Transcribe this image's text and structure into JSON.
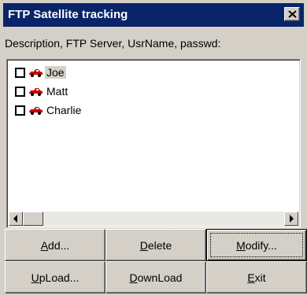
{
  "window": {
    "title": "FTP Satellite tracking",
    "close_label": "×"
  },
  "header_label": "Description, FTP Server, UsrName, passwd:",
  "list": {
    "items": [
      {
        "label": "Joe",
        "checked": false,
        "selected": true
      },
      {
        "label": "Matt",
        "checked": false,
        "selected": false
      },
      {
        "label": "Charlie",
        "checked": false,
        "selected": false
      }
    ]
  },
  "buttons": {
    "add": {
      "accel": "A",
      "rest": "dd..."
    },
    "delete": {
      "accel": "D",
      "rest": "elete"
    },
    "modify": {
      "accel": "M",
      "rest": "odify..."
    },
    "upload": {
      "accel": "U",
      "rest": "pLoad..."
    },
    "download": {
      "accel": "D",
      "rest": "ownLoad"
    },
    "exit": {
      "accel": "E",
      "rest": "xit"
    }
  },
  "colors": {
    "titlebar": "#0a246a",
    "face": "#d4d0c8",
    "icon_car": "#cc0000"
  },
  "icons": {
    "item_icon": "car-icon",
    "close": "close-icon"
  }
}
